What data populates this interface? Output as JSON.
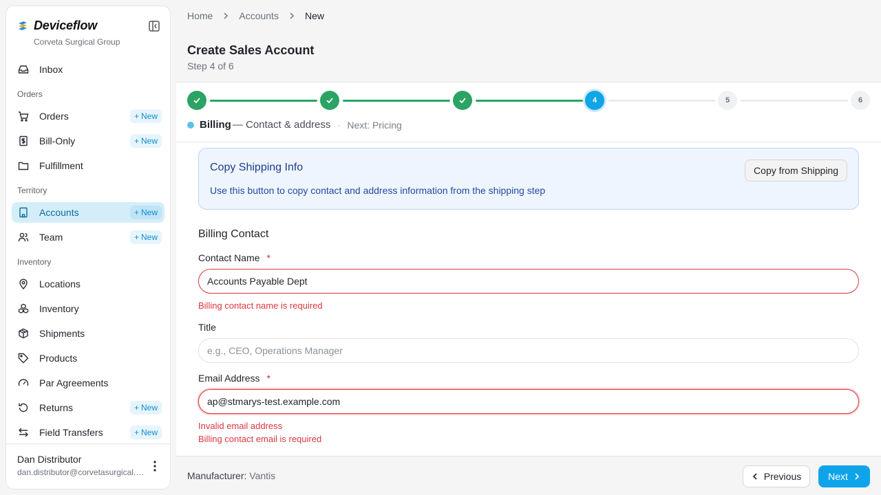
{
  "brand": {
    "name": "Deviceflow",
    "org": "Corveta Surgical Group"
  },
  "sidebar": {
    "inbox": {
      "label": "Inbox",
      "icon": "inbox-icon"
    },
    "sections": {
      "orders": "Orders",
      "territory": "Territory",
      "inventory": "Inventory"
    },
    "items": [
      {
        "label": "Orders",
        "icon": "cart-icon",
        "new": "New"
      },
      {
        "label": "Bill-Only",
        "icon": "receipt-icon",
        "new": "New"
      },
      {
        "label": "Fulfillment",
        "icon": "folder-icon"
      },
      {
        "label": "Accounts",
        "icon": "building-icon",
        "new": "New",
        "active": true
      },
      {
        "label": "Team",
        "icon": "users-icon",
        "new": "New"
      },
      {
        "label": "Locations",
        "icon": "map-pin-icon"
      },
      {
        "label": "Inventory",
        "icon": "boxes-icon"
      },
      {
        "label": "Shipments",
        "icon": "package-icon"
      },
      {
        "label": "Products",
        "icon": "tag-icon"
      },
      {
        "label": "Par Agreements",
        "icon": "gauge-icon"
      },
      {
        "label": "Returns",
        "icon": "rotate-icon",
        "new": "New"
      },
      {
        "label": "Field Transfers",
        "icon": "transfer-icon",
        "new": "New"
      }
    ],
    "user": {
      "name": "Dan Distributor",
      "email": "dan.distributor@corvetasurgical.com"
    }
  },
  "breadcrumb": [
    "Home",
    "Accounts",
    "New"
  ],
  "page": {
    "title": "Create Sales Account",
    "subtitle": "Step 4 of 6"
  },
  "stepper": {
    "steps": [
      "1",
      "2",
      "3",
      "4",
      "5",
      "6"
    ],
    "current": 4,
    "caption_title": "Billing",
    "caption_desc": "— Contact & address",
    "caption_sep": "·",
    "caption_next": "Next: Pricing"
  },
  "copy_card": {
    "title": "Copy Shipping Info",
    "description": "Use this button to copy contact and address information from the shipping step",
    "button": "Copy from Shipping"
  },
  "form": {
    "section": "Billing Contact",
    "contact_name": {
      "label": "Contact Name",
      "required": "*",
      "value": "Accounts Payable Dept",
      "error": "Billing contact name is required"
    },
    "title": {
      "label": "Title",
      "placeholder": "e.g., CEO, Operations Manager",
      "value": ""
    },
    "email": {
      "label": "Email Address",
      "required": "*",
      "value": "ap@stmarys-test.example.com",
      "errors": [
        "Invalid email address",
        "Billing contact email is required"
      ]
    }
  },
  "footer": {
    "manufacturer_label": "Manufacturer:",
    "manufacturer_value": "Vantis",
    "previous": "Previous",
    "next": "Next"
  },
  "colors": {
    "accent": "#0fa4e9",
    "done": "#2aa364",
    "error": "#d9373f",
    "active_nav": "#d4eef9"
  }
}
